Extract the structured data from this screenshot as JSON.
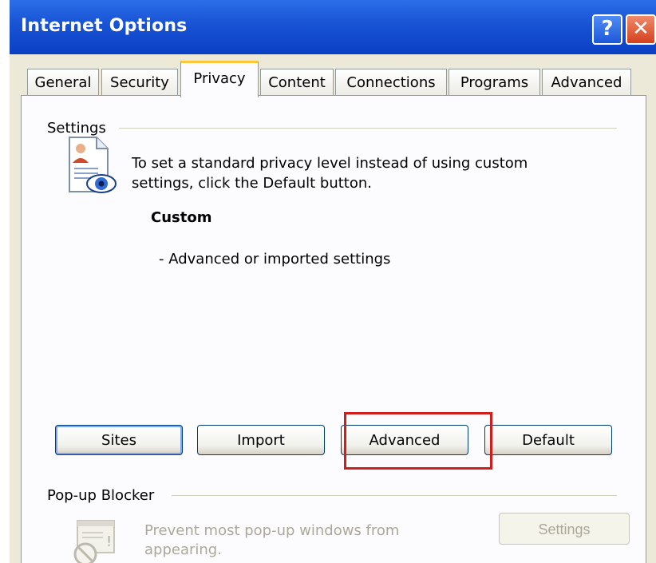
{
  "window": {
    "title": "Internet Options",
    "help_glyph": "?",
    "close_glyph": "✕"
  },
  "tabs": [
    {
      "label": "General"
    },
    {
      "label": "Security"
    },
    {
      "label": "Privacy",
      "active": true
    },
    {
      "label": "Content"
    },
    {
      "label": "Connections"
    },
    {
      "label": "Programs"
    },
    {
      "label": "Advanced"
    }
  ],
  "settings": {
    "group_label": "Settings",
    "description": "To set a standard privacy level instead of using custom settings, click the Default button.",
    "level_name": "Custom",
    "level_description": "- Advanced or imported settings",
    "icon": "privacy-document-eye-icon"
  },
  "buttons": {
    "sites": "Sites",
    "import": "Import",
    "advanced": "Advanced",
    "default": "Default"
  },
  "popup_blocker": {
    "group_label": "Pop-up Blocker",
    "description": "Prevent most pop-up windows from appearing.",
    "settings_label": "Settings",
    "enabled": false,
    "icon": "popup-blocked-icon"
  },
  "colors": {
    "titlebar": "#0a3fc4",
    "highlight_box": "#d21d1d",
    "active_tab_accent": "#ffc83c",
    "disabled_text": "#aca899"
  }
}
